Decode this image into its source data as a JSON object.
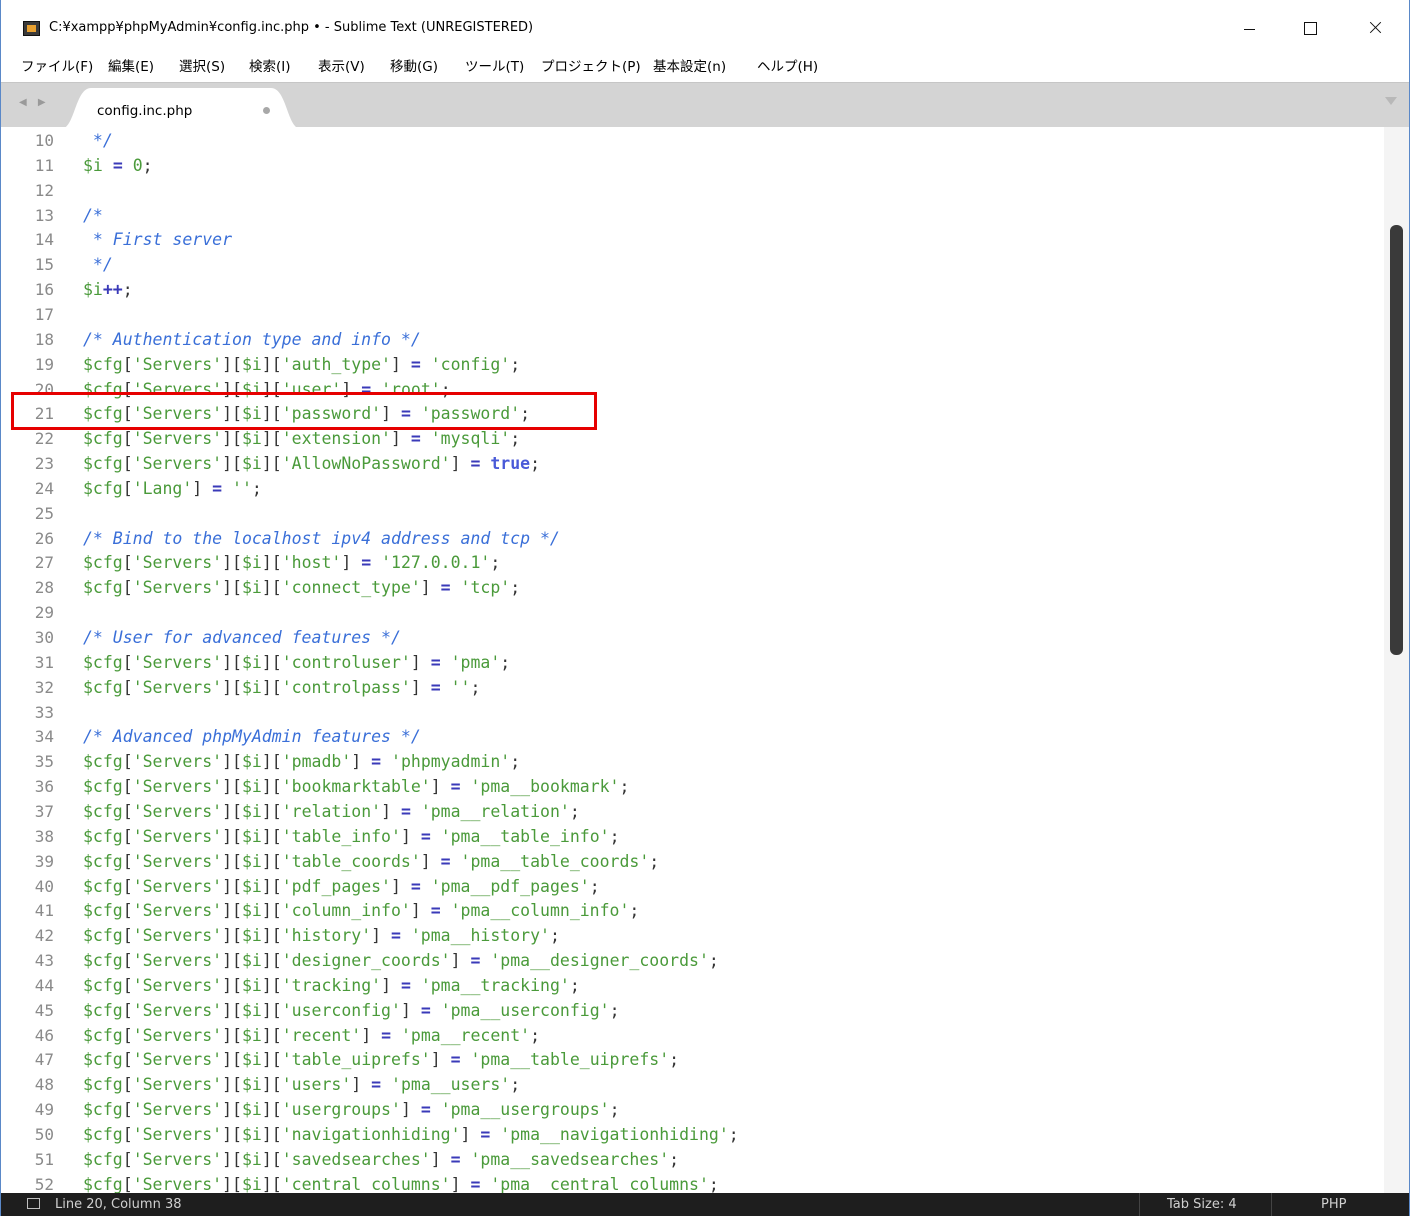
{
  "window": {
    "title": "C:¥xampp¥phpMyAdmin¥config.inc.php • - Sublime Text (UNREGISTERED)"
  },
  "menu": [
    "ファイル(F)",
    "編集(E)",
    "選択(S)",
    "検索(I)",
    "表示(V)",
    "移動(G)",
    "ツール(T)",
    "プロジェクト(P)",
    "基本設定(n)",
    "ヘルプ(H)"
  ],
  "tab": {
    "label": "config.inc.php"
  },
  "editor": {
    "lines": [
      {
        "n": "10",
        "html": "<span class='comment'> */</span>"
      },
      {
        "n": "11",
        "html": "<span class='var'>$i</span> <span class='op'>=</span> <span class='num'>0</span>;"
      },
      {
        "n": "12",
        "html": ""
      },
      {
        "n": "13",
        "html": "<span class='comment'>/*</span>"
      },
      {
        "n": "14",
        "html": "<span class='comment'> * First server</span>"
      },
      {
        "n": "15",
        "html": "<span class='comment'> */</span>"
      },
      {
        "n": "16",
        "html": "<span class='var'>$i</span><span class='op'>++</span>;"
      },
      {
        "n": "17",
        "html": ""
      },
      {
        "n": "18",
        "html": "<span class='comment'>/* Authentication type and info */</span>"
      },
      {
        "n": "19",
        "html": "<span class='var'>$cfg</span>[<span class='str'>'Servers'</span>][<span class='var'>$i</span>][<span class='str'>'auth_type'</span>] <span class='op'>=</span> <span class='str'>'config'</span>;"
      },
      {
        "n": "20",
        "html": "<span class='var'>$cfg</span>[<span class='str'>'Servers'</span>][<span class='var'>$i</span>][<span class='str'>'user'</span>] <span class='op'>=</span> <span class='str'>'root'</span>;"
      },
      {
        "n": "21",
        "html": "<span class='var'>$cfg</span>[<span class='str'>'Servers'</span>][<span class='var'>$i</span>][<span class='str'>'password'</span>] <span class='op'>=</span> <span class='str'>'password'</span>;"
      },
      {
        "n": "22",
        "html": "<span class='var'>$cfg</span>[<span class='str'>'Servers'</span>][<span class='var'>$i</span>][<span class='str'>'extension'</span>] <span class='op'>=</span> <span class='str'>'mysqli'</span>;"
      },
      {
        "n": "23",
        "html": "<span class='var'>$cfg</span>[<span class='str'>'Servers'</span>][<span class='var'>$i</span>][<span class='str'>'AllowNoPassword'</span>] <span class='op'>=</span> <span class='kw'>true</span>;"
      },
      {
        "n": "24",
        "html": "<span class='var'>$cfg</span>[<span class='str'>'Lang'</span>] <span class='op'>=</span> <span class='str'>''</span>;"
      },
      {
        "n": "25",
        "html": ""
      },
      {
        "n": "26",
        "html": "<span class='comment'>/* Bind to the localhost ipv4 address and tcp */</span>"
      },
      {
        "n": "27",
        "html": "<span class='var'>$cfg</span>[<span class='str'>'Servers'</span>][<span class='var'>$i</span>][<span class='str'>'host'</span>] <span class='op'>=</span> <span class='str'>'127.0.0.1'</span>;"
      },
      {
        "n": "28",
        "html": "<span class='var'>$cfg</span>[<span class='str'>'Servers'</span>][<span class='var'>$i</span>][<span class='str'>'connect_type'</span>] <span class='op'>=</span> <span class='str'>'tcp'</span>;"
      },
      {
        "n": "29",
        "html": ""
      },
      {
        "n": "30",
        "html": "<span class='comment'>/* User for advanced features */</span>"
      },
      {
        "n": "31",
        "html": "<span class='var'>$cfg</span>[<span class='str'>'Servers'</span>][<span class='var'>$i</span>][<span class='str'>'controluser'</span>] <span class='op'>=</span> <span class='str'>'pma'</span>;"
      },
      {
        "n": "32",
        "html": "<span class='var'>$cfg</span>[<span class='str'>'Servers'</span>][<span class='var'>$i</span>][<span class='str'>'controlpass'</span>] <span class='op'>=</span> <span class='str'>''</span>;"
      },
      {
        "n": "33",
        "html": ""
      },
      {
        "n": "34",
        "html": "<span class='comment'>/* Advanced phpMyAdmin features */</span>"
      },
      {
        "n": "35",
        "html": "<span class='var'>$cfg</span>[<span class='str'>'Servers'</span>][<span class='var'>$i</span>][<span class='str'>'pmadb'</span>] <span class='op'>=</span> <span class='str'>'phpmyadmin'</span>;"
      },
      {
        "n": "36",
        "html": "<span class='var'>$cfg</span>[<span class='str'>'Servers'</span>][<span class='var'>$i</span>][<span class='str'>'bookmarktable'</span>] <span class='op'>=</span> <span class='str'>'pma__bookmark'</span>;"
      },
      {
        "n": "37",
        "html": "<span class='var'>$cfg</span>[<span class='str'>'Servers'</span>][<span class='var'>$i</span>][<span class='str'>'relation'</span>] <span class='op'>=</span> <span class='str'>'pma__relation'</span>;"
      },
      {
        "n": "38",
        "html": "<span class='var'>$cfg</span>[<span class='str'>'Servers'</span>][<span class='var'>$i</span>][<span class='str'>'table_info'</span>] <span class='op'>=</span> <span class='str'>'pma__table_info'</span>;"
      },
      {
        "n": "39",
        "html": "<span class='var'>$cfg</span>[<span class='str'>'Servers'</span>][<span class='var'>$i</span>][<span class='str'>'table_coords'</span>] <span class='op'>=</span> <span class='str'>'pma__table_coords'</span>;"
      },
      {
        "n": "40",
        "html": "<span class='var'>$cfg</span>[<span class='str'>'Servers'</span>][<span class='var'>$i</span>][<span class='str'>'pdf_pages'</span>] <span class='op'>=</span> <span class='str'>'pma__pdf_pages'</span>;"
      },
      {
        "n": "41",
        "html": "<span class='var'>$cfg</span>[<span class='str'>'Servers'</span>][<span class='var'>$i</span>][<span class='str'>'column_info'</span>] <span class='op'>=</span> <span class='str'>'pma__column_info'</span>;"
      },
      {
        "n": "42",
        "html": "<span class='var'>$cfg</span>[<span class='str'>'Servers'</span>][<span class='var'>$i</span>][<span class='str'>'history'</span>] <span class='op'>=</span> <span class='str'>'pma__history'</span>;"
      },
      {
        "n": "43",
        "html": "<span class='var'>$cfg</span>[<span class='str'>'Servers'</span>][<span class='var'>$i</span>][<span class='str'>'designer_coords'</span>] <span class='op'>=</span> <span class='str'>'pma__designer_coords'</span>;"
      },
      {
        "n": "44",
        "html": "<span class='var'>$cfg</span>[<span class='str'>'Servers'</span>][<span class='var'>$i</span>][<span class='str'>'tracking'</span>] <span class='op'>=</span> <span class='str'>'pma__tracking'</span>;"
      },
      {
        "n": "45",
        "html": "<span class='var'>$cfg</span>[<span class='str'>'Servers'</span>][<span class='var'>$i</span>][<span class='str'>'userconfig'</span>] <span class='op'>=</span> <span class='str'>'pma__userconfig'</span>;"
      },
      {
        "n": "46",
        "html": "<span class='var'>$cfg</span>[<span class='str'>'Servers'</span>][<span class='var'>$i</span>][<span class='str'>'recent'</span>] <span class='op'>=</span> <span class='str'>'pma__recent'</span>;"
      },
      {
        "n": "47",
        "html": "<span class='var'>$cfg</span>[<span class='str'>'Servers'</span>][<span class='var'>$i</span>][<span class='str'>'table_uiprefs'</span>] <span class='op'>=</span> <span class='str'>'pma__table_uiprefs'</span>;"
      },
      {
        "n": "48",
        "html": "<span class='var'>$cfg</span>[<span class='str'>'Servers'</span>][<span class='var'>$i</span>][<span class='str'>'users'</span>] <span class='op'>=</span> <span class='str'>'pma__users'</span>;"
      },
      {
        "n": "49",
        "html": "<span class='var'>$cfg</span>[<span class='str'>'Servers'</span>][<span class='var'>$i</span>][<span class='str'>'usergroups'</span>] <span class='op'>=</span> <span class='str'>'pma__usergroups'</span>;"
      },
      {
        "n": "50",
        "html": "<span class='var'>$cfg</span>[<span class='str'>'Servers'</span>][<span class='var'>$i</span>][<span class='str'>'navigationhiding'</span>] <span class='op'>=</span> <span class='str'>'pma__navigationhiding'</span>;"
      },
      {
        "n": "51",
        "html": "<span class='var'>$cfg</span>[<span class='str'>'Servers'</span>][<span class='var'>$i</span>][<span class='str'>'savedsearches'</span>] <span class='op'>=</span> <span class='str'>'pma__savedsearches'</span>;"
      },
      {
        "n": "52",
        "html": "<span class='var'>$cfg</span>[<span class='str'>'Servers'</span>][<span class='var'>$i</span>][<span class='str'>'central_columns'</span>] <span class='op'>=</span> <span class='str'>'pma__central_columns'</span>;"
      }
    ],
    "highlighted_line": "21"
  },
  "status": {
    "position": "Line 20, Column 38",
    "tab_size": "Tab Size: 4",
    "syntax": "PHP"
  },
  "colors": {
    "highlight_border": "#e60000",
    "comment": "#3a6fd8",
    "string": "#4a9a3a",
    "statusbar": "#1e1e1e"
  },
  "icons": [
    "app-icon",
    "minimize-icon",
    "maximize-icon",
    "close-icon",
    "tab-modified-dot-icon",
    "tab-dropdown-icon",
    "panel-toggle-icon"
  ]
}
